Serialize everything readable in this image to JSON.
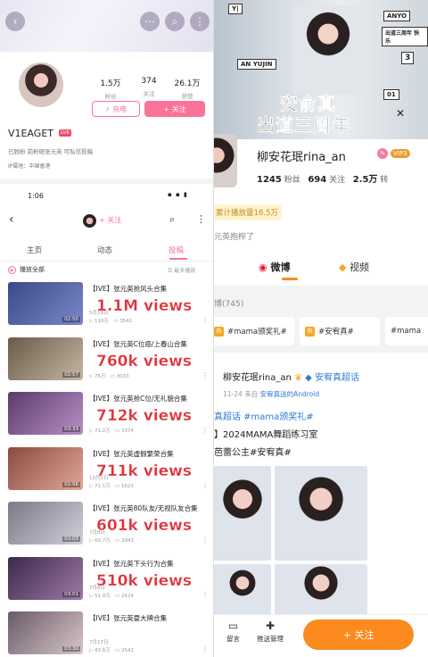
{
  "left": {
    "header": {
      "back": "‹",
      "chat": "⋯",
      "search": "⌕",
      "more": "⋮"
    },
    "profile": {
      "stats": [
        {
          "n": "1.5万",
          "l": "粉丝"
        },
        {
          "n": "374",
          "l": "关注"
        },
        {
          "n": "26.1万",
          "l": "获赞"
        }
      ],
      "charge_label": "⚡ 充电",
      "follow_label": "+ 关注",
      "username": "V1EAGET",
      "level_badge": "LV6",
      "bio": "已脱粉 前粉砸张元英 可私信投稿",
      "ip": "IP属地：中国香港"
    },
    "status_bar": {
      "time": "1:06",
      "icons": "▪ ▪ ▮"
    },
    "subheader": {
      "back": "‹",
      "follow": "+ 关注",
      "search": "⌕",
      "more": "⋮"
    },
    "tabs": [
      "主页",
      "动态",
      "投稿"
    ],
    "play_all": "播放全部",
    "sort": "最多播放",
    "videos": [
      {
        "title": "【IVE】张元英抢风头合集",
        "date": "5月19日",
        "plays": "110万",
        "danmaku": "3541",
        "duration": "02:50",
        "overlay": "1.1M views"
      },
      {
        "title": "【IVE】张元英C位癌/上春山合集",
        "date": "",
        "plays": "76万",
        "danmaku": "3033",
        "duration": "02:57",
        "overlay": "760k views"
      },
      {
        "title": "【IVE】张元英抢C位/无礼貌合集",
        "date": "",
        "plays": "71.2万",
        "danmaku": "3374",
        "duration": "03:33",
        "overlay": "712k views"
      },
      {
        "title": "【IVE】张元英虚假繁荣合集",
        "date": "10月1日",
        "plays": "71.1万",
        "danmaku": "1623",
        "duration": "02:56",
        "overlay": "711k views"
      },
      {
        "title": "【IVE】张元英80队友/无视队友合集",
        "date": "7月8日",
        "plays": "60.7万",
        "danmaku": "2943",
        "duration": "03:03",
        "overlay": "601k views"
      },
      {
        "title": "【IVE】张元英下头行为合集",
        "date": "7月8日",
        "plays": "51.9万",
        "danmaku": "2424",
        "duration": "03:01",
        "overlay": "510k views"
      },
      {
        "title": "【IVE】张元英耍大牌合集",
        "date": "7月17日",
        "plays": "43.6万",
        "danmaku": "2542",
        "duration": "03:30",
        "overlay": ""
      }
    ]
  },
  "right": {
    "banner": {
      "line1": "安俞真",
      "line2": "出道三周年",
      "stickers": [
        "Y|",
        "AN YUJIN",
        "ANYO",
        "出道三周年 快乐",
        "3",
        "01"
      ],
      "close": "✕"
    },
    "profile": {
      "name": "柳安花珉rina_an",
      "vip": "VIP3",
      "fans": "1245",
      "fans_label": "粉丝",
      "following": "694",
      "following_label": "关注",
      "likes": "2.5万",
      "likes_label": "转"
    },
    "play_count": "累计播放量16.5万",
    "bio": "元英抱榨了",
    "tabs": [
      "微博",
      "视频"
    ],
    "tweet_count": "博(745)",
    "chips": [
      "#mama颁奖礼#",
      "#安宥真#",
      "#mama"
    ],
    "post": {
      "name": "柳安花珉rina_an",
      "super": "安宥真超话",
      "time": "11-24",
      "source_prefix": "来自",
      "source": "安宥真送的Android",
      "line1": "真超话 #mama颁奖礼#",
      "line2": "】2024MAMA舞蹈练习室",
      "line3": "芭蕾公主#安宥真#"
    },
    "bottom": {
      "message": "留言",
      "push": "推送管理",
      "follow": "+ 关注"
    }
  },
  "colors": {
    "bili_pink": "#fb7299",
    "overlay_red": "#e0323c",
    "weibo_orange": "#fb8a1f",
    "weibo_blue": "#2d7bd6"
  }
}
